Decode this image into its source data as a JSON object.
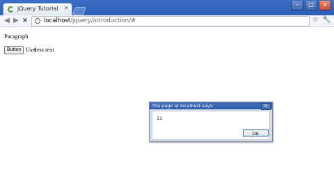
{
  "browser": {
    "tab_title": "jQuery Tutorial",
    "tab_close": "×",
    "url_host": "localhost",
    "url_path": "/jquery/introduction/#"
  },
  "page": {
    "paragraph": "Paragraph",
    "button_label": "Button",
    "label_text": "Useless text"
  },
  "dialog": {
    "title": "The page at localhost says:",
    "message": "11",
    "ok_label": "OK"
  },
  "colors": {
    "titlebar": "#3a6fc8",
    "dialog_title": "#2f5aa7",
    "accent": "#2c5fb1"
  },
  "icons": {
    "back": "arrow-left",
    "forward": "arrow-right",
    "stop": "close",
    "site": "globe",
    "bookmark": "star",
    "menu": "wrench"
  }
}
